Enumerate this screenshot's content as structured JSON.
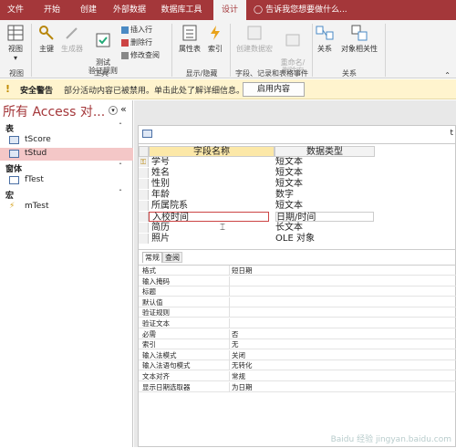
{
  "tabs": [
    "文件",
    "开始",
    "创建",
    "外部数据",
    "数据库工具",
    "设计"
  ],
  "tell_me": "告诉我您想要做什么...",
  "ribbon": {
    "view": "视图",
    "primary_key": "主键",
    "builder": "生成器",
    "test_rules": "测试\n验证规则",
    "insert_rows": "插入行",
    "delete_rows": "删除行",
    "modify_lookups": "修改查阅",
    "property_sheet": "属性表",
    "indexes": "索引",
    "create_macros": "创建数据宏",
    "rename_delete": "重命名/\n删除宏",
    "relationships": "关系",
    "object_dependencies": "对象相关性",
    "groups": {
      "views": "视图",
      "tools": "工具",
      "show_hide": "显示/隐藏",
      "field_events": "字段、记录和表格事件",
      "relationships": "关系"
    }
  },
  "message_bar": {
    "title": "安全警告",
    "text": "部分活动内容已被禁用。单击此处了解详细信息。",
    "button": "启用内容"
  },
  "nav": {
    "title": "所有 Access 对...",
    "groups": [
      {
        "label": "表",
        "items": [
          "tScore",
          "tStud"
        ]
      },
      {
        "label": "窗体",
        "items": [
          "fTest"
        ]
      },
      {
        "label": "宏",
        "items": [
          "mTest"
        ]
      }
    ]
  },
  "doc_tab": "t",
  "grid": {
    "headers": [
      "字段名称",
      "数据类型"
    ],
    "rows": [
      [
        "学号",
        "短文本"
      ],
      [
        "姓名",
        "短文本"
      ],
      [
        "性别",
        "短文本"
      ],
      [
        "年龄",
        "数字"
      ],
      [
        "所属院系",
        "短文本"
      ],
      [
        "入校时间",
        "日期/时间"
      ],
      [
        "简历",
        "长文本"
      ],
      [
        "照片",
        "OLE 对象"
      ]
    ]
  },
  "prop_tabs": [
    "常规",
    "查阅"
  ],
  "properties": [
    [
      "格式",
      "短日期"
    ],
    [
      "输入掩码",
      ""
    ],
    [
      "标题",
      ""
    ],
    [
      "默认值",
      ""
    ],
    [
      "验证规则",
      ""
    ],
    [
      "验证文本",
      ""
    ],
    [
      "必需",
      "否"
    ],
    [
      "索引",
      "无"
    ],
    [
      "输入法模式",
      "关闭"
    ],
    [
      "输入法语句模式",
      "无转化"
    ],
    [
      "文本对齐",
      "常规"
    ],
    [
      "显示日期选取器",
      "为日期"
    ]
  ],
  "watermark": "Baidu 经验 jingyan.baidu.com",
  "colors": {
    "accent": "#a4373a",
    "selected_nav": "#f4c7c7",
    "msg_bg": "#fff4ce",
    "header_bg": "#fce8a8"
  }
}
